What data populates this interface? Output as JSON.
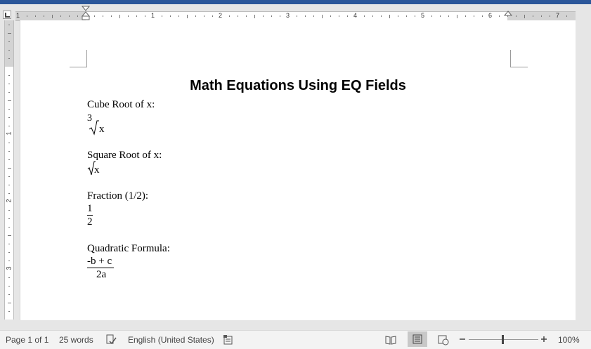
{
  "document": {
    "title": "Math Equations Using EQ Fields",
    "sections": [
      {
        "label": "Cube Root of x:",
        "index": "3",
        "radicand": "x"
      },
      {
        "label": "Square Root of x:",
        "radicand": "x"
      },
      {
        "label": "Fraction (1/2):",
        "numerator": "1",
        "denominator": "2"
      },
      {
        "label": "Quadratic Formula:",
        "numerator": "-b + c",
        "denominator": "2a"
      }
    ]
  },
  "ruler": {
    "horizontal_numbers": [
      "1",
      "1",
      "2",
      "3",
      "4",
      "5",
      "6",
      "7"
    ],
    "vertical_numbers": [
      "1",
      "2",
      "3"
    ]
  },
  "statusbar": {
    "page": "Page 1 of 1",
    "words": "25 words",
    "language": "English (United States)",
    "zoom": "100%",
    "icons": [
      "proofing-icon",
      "macro-icon",
      "read-mode-icon",
      "print-layout-icon",
      "web-layout-icon",
      "zoom-out-icon",
      "zoom-in-icon"
    ]
  },
  "colors": {
    "title_bar": "#2b579a",
    "page": "#ffffff",
    "workspace": "#e6e6e6"
  }
}
